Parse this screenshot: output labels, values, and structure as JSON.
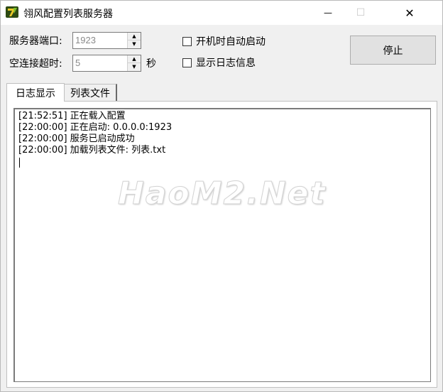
{
  "window": {
    "title": "翎风配置列表服务器",
    "minimize_glyph": "—",
    "maximize_glyph": "☐",
    "close_glyph": "✕"
  },
  "form": {
    "port_label": "服务器端口:",
    "port_value": "1923",
    "timeout_label": "空连接超时:",
    "timeout_value": "5",
    "timeout_unit": "秒",
    "autostart_label": "开机时自动启动",
    "autostart_checked": false,
    "showlog_label": "显示日志信息",
    "showlog_checked": false,
    "stop_button": "停止"
  },
  "tabs": [
    {
      "label": "日志显示",
      "active": true
    },
    {
      "label": "列表文件",
      "active": false
    }
  ],
  "log": [
    "[21:52:51] 正在载入配置",
    "[22:00:00] 正在启动: 0.0.0.0:1923",
    "[22:00:00] 服务已启动成功",
    "[22:00:00] 加载列表文件: 列表.txt"
  ],
  "watermark": "HaoM2.Net",
  "colors": {
    "icon_green": "#5a7d1a",
    "icon_yellow": "#e8c828"
  }
}
